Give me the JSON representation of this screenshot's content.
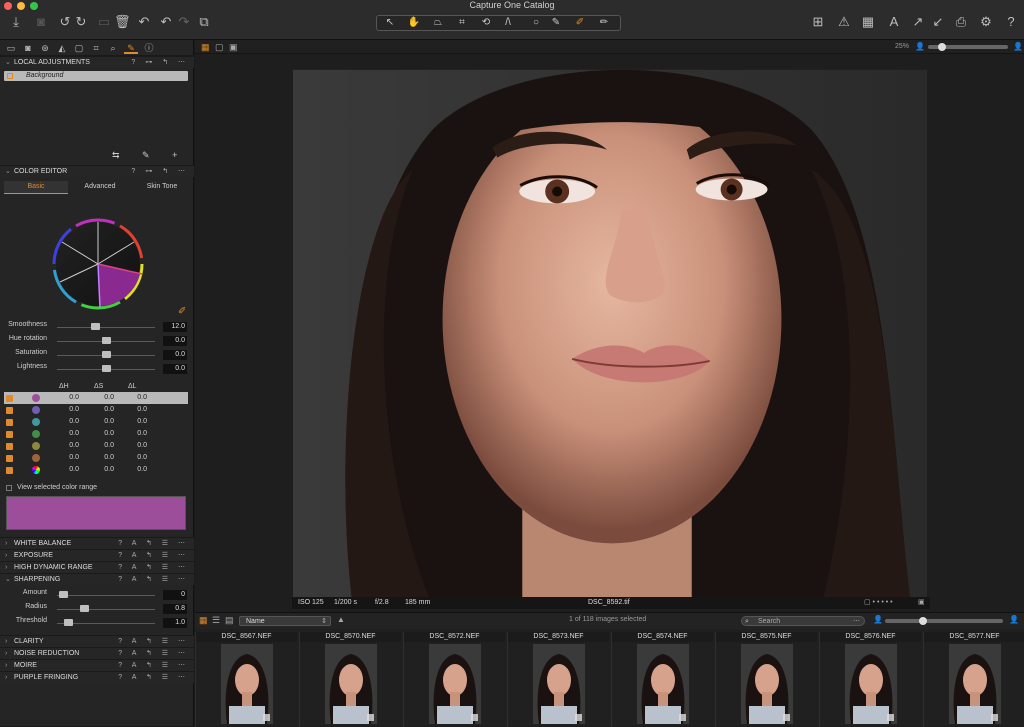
{
  "window": {
    "title": "Capture One Catalog"
  },
  "colors": {
    "accent": "#e08a2a",
    "selected_swatch": "#9c4e9a"
  },
  "toolbar": {
    "left_icons": [
      "import-icon",
      "camera-icon",
      "rotate-left-icon",
      "rotate-right-icon",
      "folder-icon",
      "trash-icon",
      "undo-icon",
      "undo2-icon",
      "redo-icon",
      "copy-icon"
    ],
    "cursor_tools": [
      "select-icon",
      "pan-icon",
      "keystone-icon",
      "crop-icon",
      "rotate-icon",
      "straighten-icon",
      "spot-icon",
      "brush-icon",
      "picker-icon",
      "annotate-icon"
    ],
    "right_icons": [
      "grid-icon",
      "warning-icon",
      "checker-icon",
      "text-icon",
      "expand-icon",
      "print-icon",
      "gear-icon",
      "help-icon"
    ],
    "zoom": "25%"
  },
  "left": {
    "local_adjustments": {
      "title": "LOCAL ADJUSTMENTS",
      "layer": "Background"
    },
    "color_editor": {
      "title": "COLOR EDITOR",
      "tabs": [
        "Basic",
        "Advanced",
        "Skin Tone"
      ],
      "sliders": [
        {
          "label": "Smoothness",
          "value": "12.0",
          "pos": 0.38
        },
        {
          "label": "Hue rotation",
          "value": "0.0",
          "pos": 0.5
        },
        {
          "label": "Saturation",
          "value": "0.0",
          "pos": 0.5
        },
        {
          "label": "Lightness",
          "value": "0.0",
          "pos": 0.5
        }
      ],
      "headers": [
        "ΔH",
        "ΔS",
        "ΔL"
      ],
      "rows": [
        {
          "color": "#9c4e9a",
          "h": "0.0",
          "s": "0.0",
          "l": "0.0"
        },
        {
          "color": "#6d5fb5",
          "h": "0.0",
          "s": "0.0",
          "l": "0.0"
        },
        {
          "color": "#3f9aa0",
          "h": "0.0",
          "s": "0.0",
          "l": "0.0"
        },
        {
          "color": "#3e8f4a",
          "h": "0.0",
          "s": "0.0",
          "l": "0.0"
        },
        {
          "color": "#8a8a3a",
          "h": "0.0",
          "s": "0.0",
          "l": "0.0"
        },
        {
          "color": "#a0643a",
          "h": "0.0",
          "s": "0.0",
          "l": "0.0"
        },
        {
          "color": "#cc66cc",
          "h": "0.0",
          "s": "0.0",
          "l": "0.0"
        }
      ],
      "view_selected": "View selected color range"
    },
    "sections": [
      "WHITE BALANCE",
      "EXPOSURE",
      "HIGH DYNAMIC RANGE"
    ],
    "sharpening": {
      "title": "SHARPENING",
      "sliders": [
        {
          "label": "Amount",
          "value": "0",
          "pos": 0.02
        },
        {
          "label": "Radius",
          "value": "0.8",
          "pos": 0.26
        },
        {
          "label": "Threshold",
          "value": "1.0",
          "pos": 0.08
        }
      ]
    },
    "sections2": [
      "CLARITY",
      "NOISE REDUCTION",
      "MOIRE",
      "PURPLE FRINGING"
    ]
  },
  "viewer": {
    "iso": "ISO 125",
    "shutter": "1/200 s",
    "aperture": "f/2.8",
    "focal": "185 mm",
    "filename": "DSC_8592.tif"
  },
  "browser": {
    "sort": "Name",
    "count": "1 of 118 images selected",
    "search_placeholder": "Search",
    "files": [
      "DSC_8567.NEF",
      "DSC_8570.NEF",
      "DSC_8572.NEF",
      "DSC_8573.NEF",
      "DSC_8574.NEF",
      "DSC_8575.NEF",
      "DSC_8576.NEF",
      "DSC_8577.NEF"
    ]
  }
}
